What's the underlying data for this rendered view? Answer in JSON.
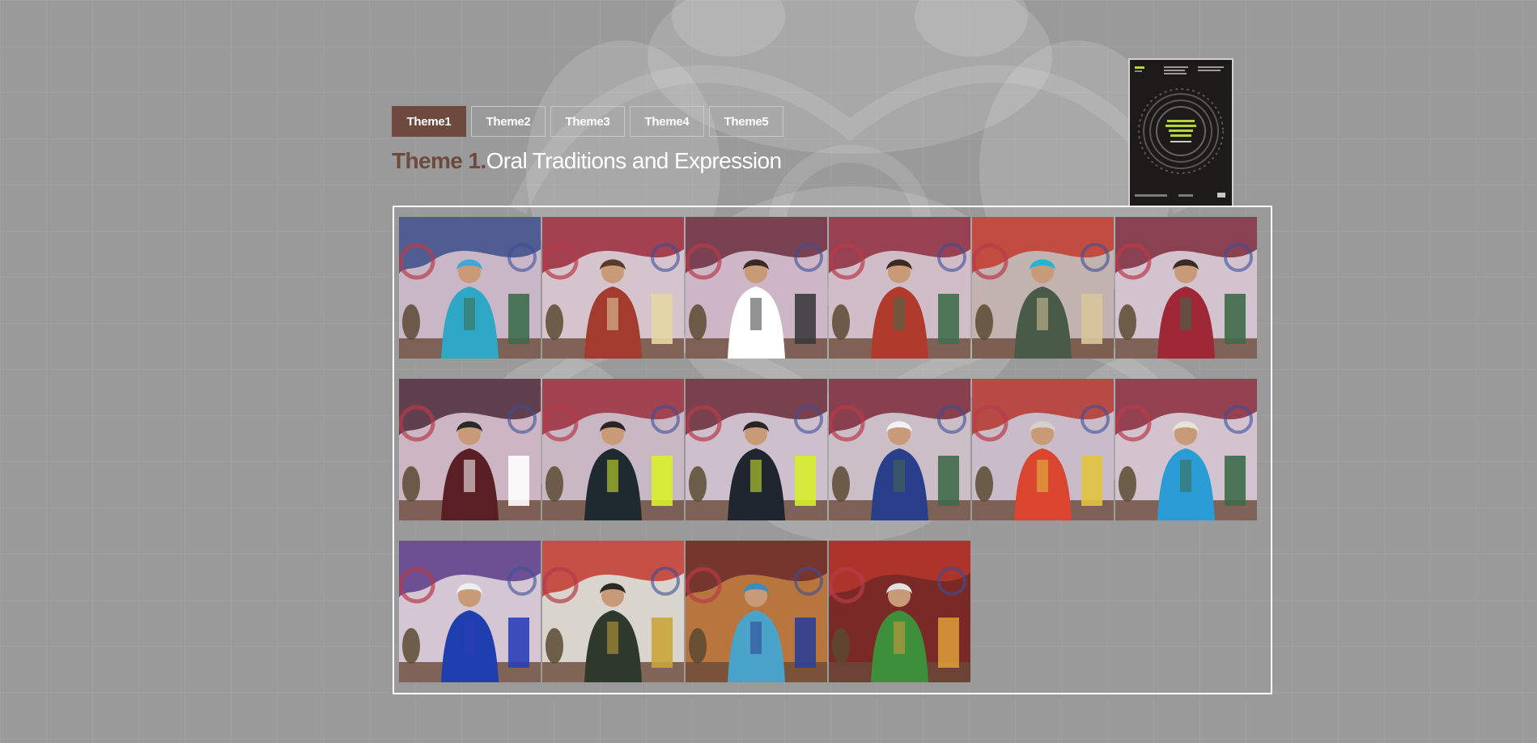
{
  "tabs": [
    {
      "label": "Theme1",
      "active": true
    },
    {
      "label": "Theme2",
      "active": false
    },
    {
      "label": "Theme3",
      "active": false
    },
    {
      "label": "Theme4",
      "active": false
    },
    {
      "label": "Theme5",
      "active": false
    }
  ],
  "heading": {
    "prefix": "Theme 1.",
    "title": "Oral Traditions and Expression"
  },
  "colors": {
    "accent": "#6e4a3e",
    "page_background": "#9a9a9a",
    "cover_background": "#1c1b1a",
    "cover_accent": "#b6d33a"
  },
  "gallery": {
    "photos": [
      {
        "bg": "#c9b7c8",
        "drape": "#3b4e8a",
        "figure": "#2fa7c6",
        "head": "#3ea6d8",
        "accent": "#3d6b4a"
      },
      {
        "bg": "#d6c4cc",
        "drape": "#9a2a3a",
        "figure": "#a33b2f",
        "head": "#5a3a2a",
        "accent": "#e6d7a4"
      },
      {
        "bg": "#cdb7c6",
        "drape": "#6a2d3c",
        "figure": "#ffffff",
        "head": "#3a2b22",
        "accent": "#3b3b3b"
      },
      {
        "bg": "#d1bdc8",
        "drape": "#8d2b3d",
        "figure": "#b03a2c",
        "head": "#3a2a22",
        "accent": "#3f6e4b"
      },
      {
        "bg": "#c2b3b0",
        "drape": "#c23a2b",
        "figure": "#4a5a48",
        "head": "#1fb5d3",
        "accent": "#d8c79a"
      },
      {
        "bg": "#d3c3cf",
        "drape": "#7d2a3c",
        "figure": "#9e2836",
        "head": "#3a2a22",
        "accent": "#3d6a48"
      },
      {
        "bg": "#cdb6c4",
        "drape": "#4c2a3a",
        "figure": "#5a1f24",
        "head": "#2c2a28",
        "accent": "#ffffff"
      },
      {
        "bg": "#c8b8c4",
        "drape": "#9b2e3d",
        "figure": "#1f2a2e",
        "head": "#2a2422",
        "accent": "#d9f02c"
      },
      {
        "bg": "#cdc0cc",
        "drape": "#6a2a36",
        "figure": "#1f2630",
        "head": "#2a2422",
        "accent": "#d6ee2a"
      },
      {
        "bg": "#ccbec7",
        "drape": "#7b2a3a",
        "figure": "#2a3f8c",
        "head": "#f2f2f2",
        "accent": "#3f6b4a"
      },
      {
        "bg": "#c9bcc8",
        "drape": "#b5362f",
        "figure": "#d9452e",
        "head": "#d7d1c9",
        "accent": "#e2c341"
      },
      {
        "bg": "#d2c3cf",
        "drape": "#8a2b3c",
        "figure": "#2a9dd6",
        "head": "#e8e3d8",
        "accent": "#3c6a47"
      },
      {
        "bg": "#d4c6d2",
        "drape": "#5a3b8a",
        "figure": "#1f3fb0",
        "head": "#eeeeee",
        "accent": "#2a3fb5"
      },
      {
        "bg": "#d9d4cc",
        "drape": "#c2372e",
        "figure": "#2d3a2c",
        "head": "#2a2a22",
        "accent": "#c9a53a"
      },
      {
        "bg": "#b8763e",
        "drape": "#6a2a2a",
        "figure": "#4aa3c9",
        "head": "#3a8fb8",
        "accent": "#2d3f93"
      },
      {
        "bg": "#7a2a26",
        "drape": "#b5362c",
        "figure": "#3e8f3a",
        "head": "#e2e2e2",
        "accent": "#d99a3a"
      }
    ]
  }
}
